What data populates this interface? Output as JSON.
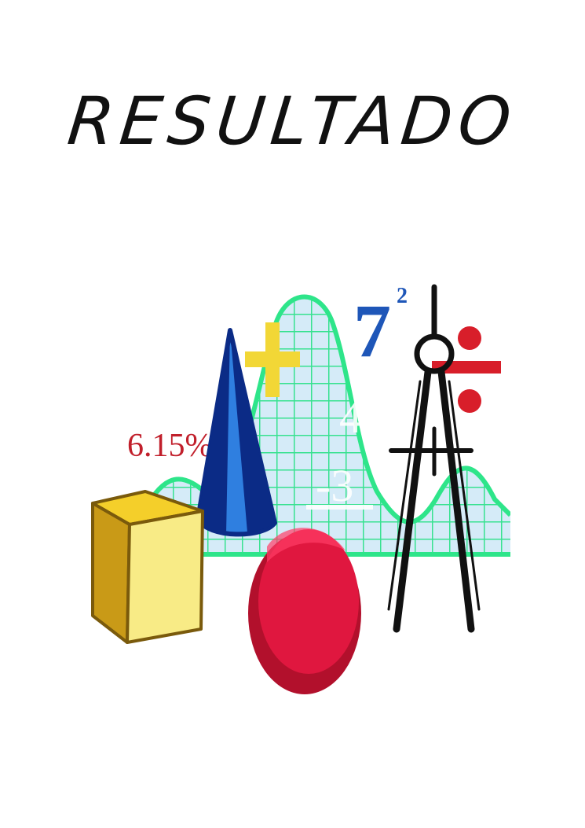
{
  "page": {
    "title": "RESULTADO"
  },
  "clipart": {
    "percent_label": "6.15%",
    "exponent_base": "7",
    "exponent_power": "2",
    "arith_top": "4",
    "arith_bottom": "-3",
    "colors": {
      "title": "#111111",
      "graph_line": "#2ee58a",
      "graph_fill": "#cfe8f7",
      "cone_dark": "#0b2b86",
      "cone_light": "#2f7fe0",
      "cube_top": "#f4cf2a",
      "cube_front": "#f8eb86",
      "cube_side": "#c99a17",
      "sphere": "#e0173f",
      "plus": "#f2d736",
      "divide": "#d81e2a",
      "percent": "#c11f2b",
      "seven": "#1e56b8"
    },
    "icons": [
      "plus-sign-icon",
      "divide-sign-icon",
      "compass-icon",
      "cone-icon",
      "cube-icon",
      "sphere-icon",
      "graph-curve-icon"
    ]
  }
}
